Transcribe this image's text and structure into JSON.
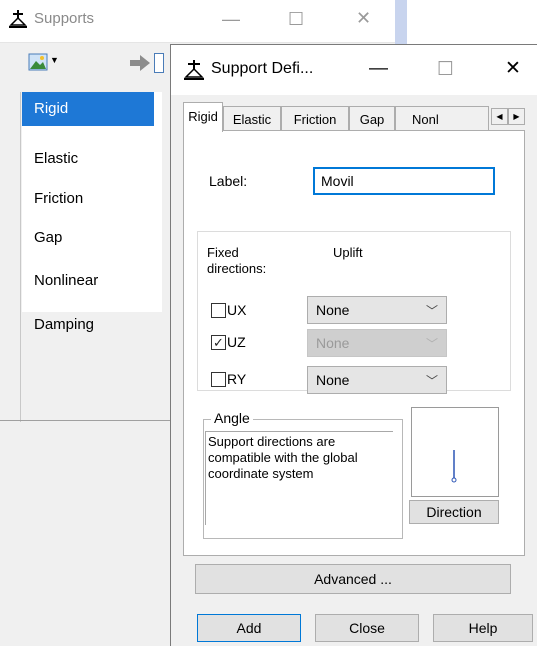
{
  "supports_window": {
    "title": "Supports",
    "minimize": "—",
    "maximize": "☐",
    "close": "✕",
    "list_items": [
      "Rigid",
      "Elastic",
      "Friction",
      "Gap",
      "Nonlinear",
      "Damping"
    ],
    "selected_index": 0
  },
  "dialog": {
    "title": "Support Defi...",
    "minimize": "—",
    "maximize": "☐",
    "close": "✕",
    "tabs": [
      "Rigid",
      "Elastic",
      "Friction",
      "Gap",
      "Nonl"
    ],
    "active_tab": "Rigid",
    "label_caption": "Label:",
    "label_value": "Movil",
    "fixed_directions_caption": "Fixed directions:",
    "uplift_caption": "Uplift",
    "directions": [
      {
        "name": "UX",
        "checked": false,
        "uplift": "None",
        "uplift_enabled": true
      },
      {
        "name": "UZ",
        "checked": true,
        "uplift": "None",
        "uplift_enabled": false
      },
      {
        "name": "RY",
        "checked": false,
        "uplift": "None",
        "uplift_enabled": true
      }
    ],
    "angle_caption": "Angle",
    "angle_text": "Support directions are compatible with the global coordinate system",
    "direction_button": "Direction",
    "advanced_button": "Advanced ...",
    "add_button": "Add",
    "close_button": "Close",
    "help_button": "Help"
  },
  "colors": {
    "selection": "#1e78d6",
    "focus_border": "#0078d7",
    "dialog_bg": "#f0f0f0"
  }
}
